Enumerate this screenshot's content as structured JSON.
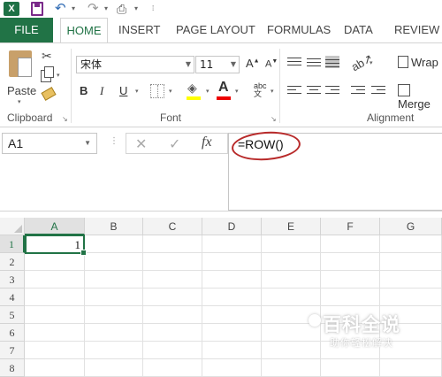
{
  "app": {
    "logo_text": "X"
  },
  "colors": {
    "brand": "#217346",
    "annotation": "#b82a2a",
    "fill_highlight": "#ffff00",
    "font_color": "#e00000"
  },
  "tabs": [
    {
      "label": "FILE"
    },
    {
      "label": "HOME"
    },
    {
      "label": "INSERT"
    },
    {
      "label": "PAGE LAYOUT"
    },
    {
      "label": "FORMULAS"
    },
    {
      "label": "DATA"
    },
    {
      "label": "REVIEW"
    }
  ],
  "ribbon": {
    "paste_label": "Paste",
    "clipboard_label": "Clipboard",
    "font_label": "Font",
    "alignment_label": "Alignment",
    "font_name": "宋体",
    "font_size": "11",
    "bold": "B",
    "italic": "I",
    "underline": "U",
    "font_color_glyph": "A",
    "size_up": "A",
    "size_down": "A",
    "wrap_label": "Wrap",
    "merge_label": "Merge"
  },
  "formula_bar": {
    "name_box": "A1",
    "formula": "=ROW()",
    "fx_label": "fx"
  },
  "sheet": {
    "columns": [
      "A",
      "B",
      "C",
      "D",
      "E",
      "F",
      "G"
    ],
    "rows": [
      "1",
      "2",
      "3",
      "4",
      "5",
      "6",
      "7",
      "8"
    ],
    "active_cell": "A1",
    "cells": {
      "A1": "1"
    }
  },
  "watermark": {
    "title": "百科全说",
    "subtitle": "助你轻松解决"
  }
}
